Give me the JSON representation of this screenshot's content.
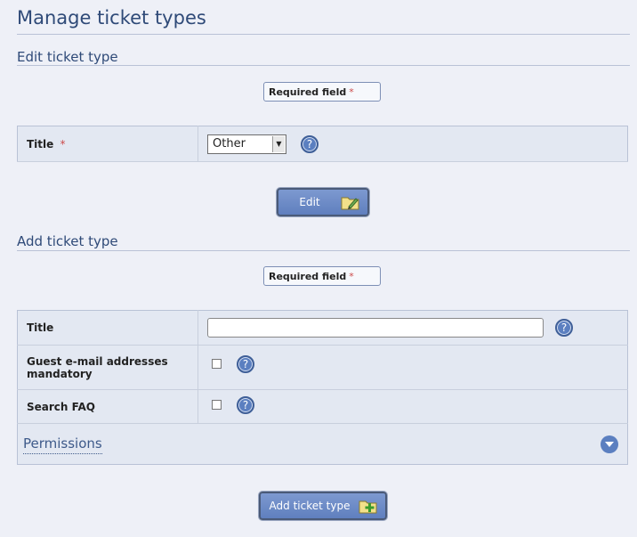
{
  "page": {
    "title": "Manage ticket types"
  },
  "edit_section": {
    "heading": "Edit ticket type",
    "required_label": "Required field",
    "required_marker": "*",
    "fields": {
      "title_label": "Title",
      "title_marker": "*",
      "title_selected": "Other"
    },
    "help_symbol": "?",
    "submit_label": "Edit"
  },
  "add_section": {
    "heading": "Add ticket type",
    "required_label": "Required field",
    "required_marker": "*",
    "fields": {
      "title_label": "Title",
      "title_value": "",
      "guest_email_label": "Guest e-mail addresses mandatory",
      "guest_email_checked": false,
      "search_faq_label": "Search FAQ",
      "search_faq_checked": false
    },
    "help_symbol": "?",
    "permissions_label": "Permissions",
    "submit_label": "Add ticket type"
  },
  "icons": {
    "help": "help-icon",
    "edit_folder": "folder-edit-icon",
    "add_folder": "folder-add-icon",
    "expand": "chevron-down-icon"
  },
  "colors": {
    "accent": "#5b7fc0",
    "heading": "#2f4a78",
    "background": "#eef0f7",
    "required_star": "#cc4a4a"
  }
}
